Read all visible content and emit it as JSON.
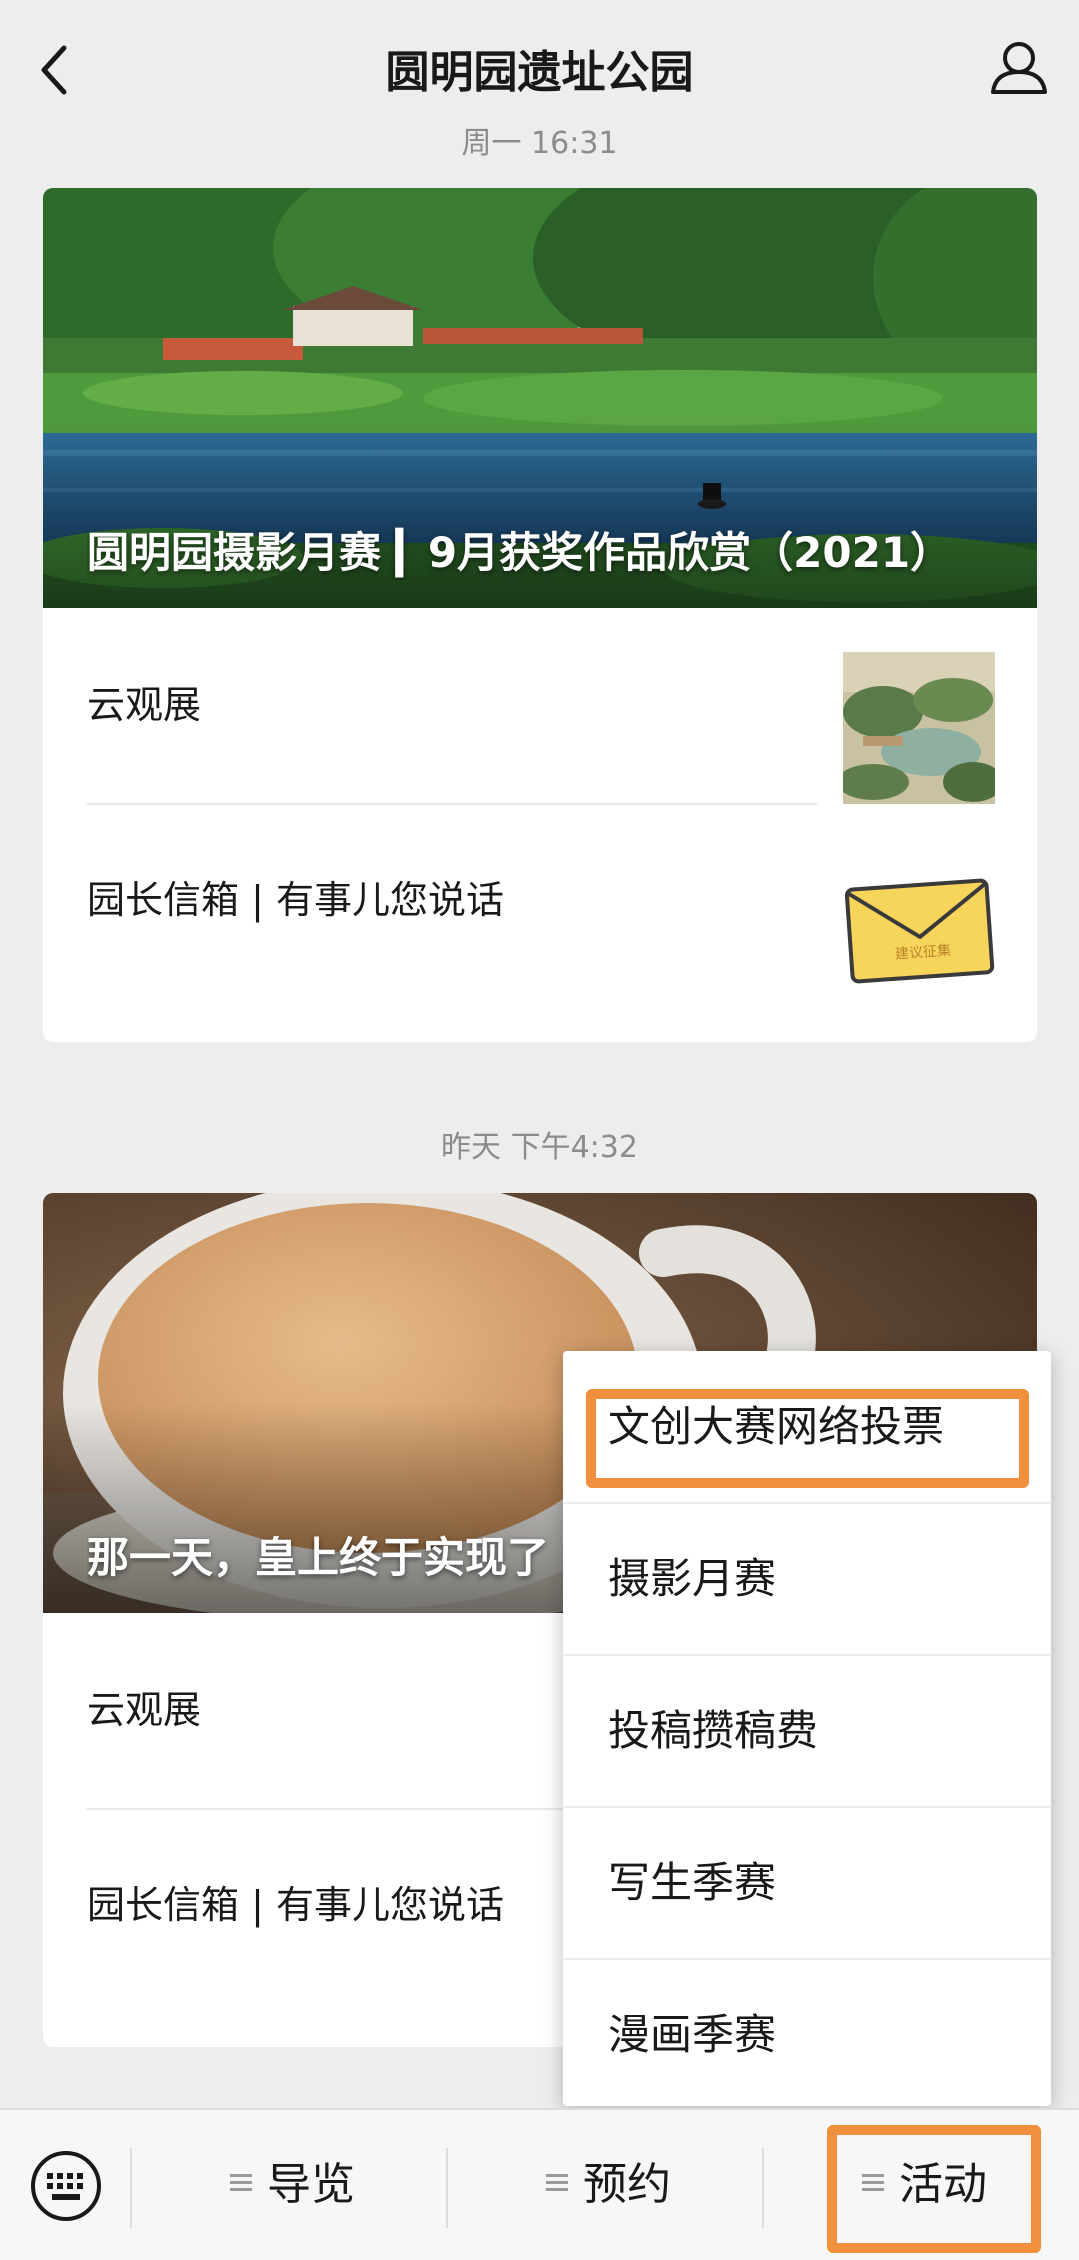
{
  "header": {
    "title": "圆明园遗址公园"
  },
  "messages": [
    {
      "timestamp": "周一 16:31",
      "cover_title": "圆明园摄影月赛 ▎9月获奖作品欣赏（2021）",
      "items": [
        {
          "label": "云观展",
          "thumb": "garden-painting"
        },
        {
          "label": "园长信箱 | 有事儿您说话",
          "thumb": "envelope-icon",
          "thumb_text": "建议征集"
        }
      ]
    },
    {
      "timestamp": "昨天 下午4:32",
      "cover_title": "那一天，皇上终于实现了",
      "items": [
        {
          "label": "云观展"
        },
        {
          "label": "园长信箱 | 有事儿您说话"
        }
      ]
    }
  ],
  "popup_menu": {
    "items": [
      {
        "label": "文创大赛网络投票",
        "highlighted": true
      },
      {
        "label": "摄影月赛"
      },
      {
        "label": "投稿攒稿费"
      },
      {
        "label": "写生季赛"
      },
      {
        "label": "漫画季赛"
      }
    ]
  },
  "bottom_menu": {
    "keyboard_icon": "keyboard-icon",
    "items": [
      {
        "label": "导览"
      },
      {
        "label": "预约"
      },
      {
        "label": "活动",
        "highlighted": true
      }
    ]
  },
  "colors": {
    "background": "#ededed",
    "highlight": "#f0903c",
    "text": "#191919",
    "muted": "#8c8c8c"
  }
}
